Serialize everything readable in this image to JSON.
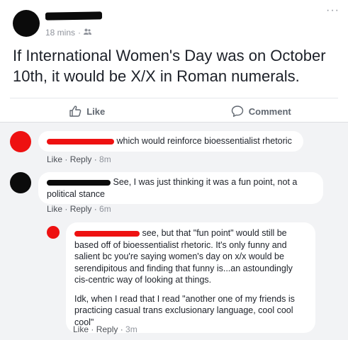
{
  "post": {
    "time": "18 mins",
    "separator": "·",
    "audience_icon": "friends-icon",
    "text": "If International Women's Day was on October 10th, it would be X/X in Roman numerals.",
    "like_label": "Like",
    "comment_label": "Comment"
  },
  "comments": [
    {
      "text": "which would reinforce bioessentialist rhetoric",
      "like": "Like",
      "reply": "Reply",
      "time": "8m"
    },
    {
      "text": "See, I was just thinking it was a fun point, not a political stance",
      "like": "Like",
      "reply": "Reply",
      "time": "6m"
    },
    {
      "text": "see, but that \"fun point\" would still be based off of bioessentialist rhetoric. It's only funny and salient bc you're saying women's day on x/x would be serendipitous and finding that funny is...an astoundingly cis-centric way of looking at things.",
      "text2": "Idk, when I read that I read \"another one of my friends is practicing casual trans exclusionary language, cool cool cool\"",
      "like": "Like",
      "reply": "Reply",
      "time": "3m"
    }
  ],
  "colors": {
    "text": "#1d2129",
    "meta": "#90949c",
    "comment_bg": "#f2f3f5",
    "redaction_red": "#ee1111",
    "redaction_black": "#0b0b0b"
  }
}
